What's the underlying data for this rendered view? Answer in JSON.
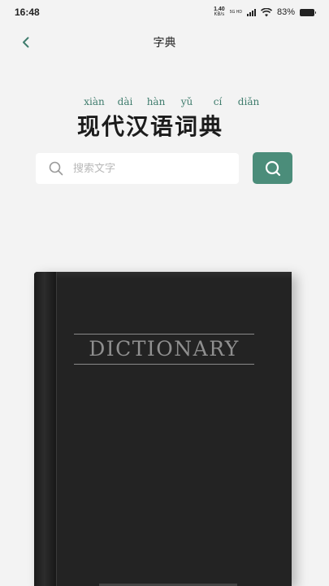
{
  "status_bar": {
    "time": "16:48",
    "net_speed_value": "1.40",
    "net_speed_unit": "KB/s",
    "network_badge_top": "5G HD",
    "network_badge_bottom": "",
    "battery_percent": "83%"
  },
  "header": {
    "title": "字典",
    "back_icon": "chevron-left-icon"
  },
  "title_block": {
    "pinyin": [
      "xiàn",
      "dài",
      "hàn",
      "yǔ",
      "cí",
      "diǎn"
    ],
    "title": "现代汉语词典"
  },
  "search": {
    "placeholder": "搜索文字",
    "value": "",
    "icon": "search-icon",
    "button_icon": "search-icon"
  },
  "book": {
    "cover_text": "DICTIONARY"
  },
  "colors": {
    "accent": "#4b8d7a",
    "pinyin": "#3f7c6d",
    "background": "#f3f3f3",
    "book": "#232323"
  }
}
